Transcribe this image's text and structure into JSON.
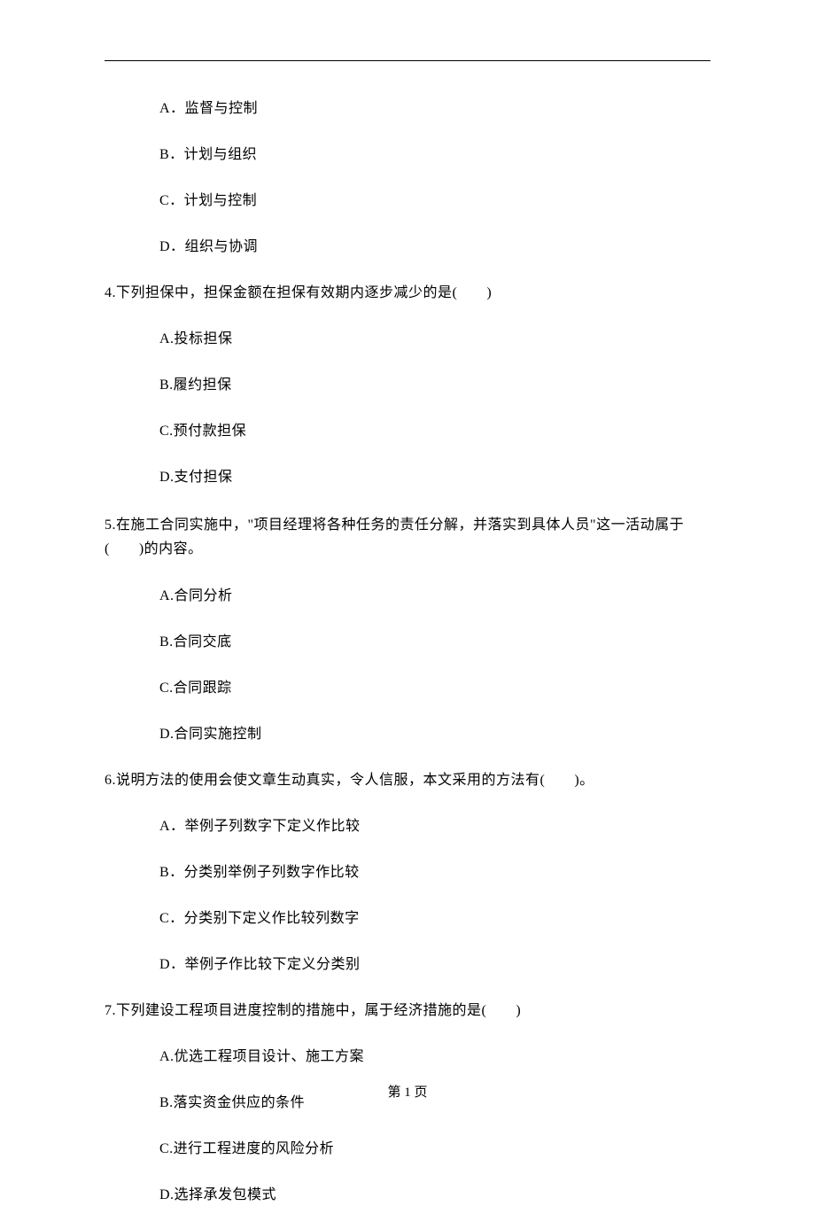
{
  "options_block_1": {
    "a": "A．监督与控制",
    "b": "B．计划与组织",
    "c": "C．计划与控制",
    "d": "D．组织与协调"
  },
  "q4": {
    "stem": "4.下列担保中，担保金额在担保有效期内逐步减少的是(　　)",
    "a": "A.投标担保",
    "b": "B.履约担保",
    "c": "C.预付款担保",
    "d": "D.支付担保"
  },
  "q5": {
    "stem": "5.在施工合同实施中，\"项目经理将各种任务的责任分解，并落实到具体人员\"这一活动属于(　　)的内容。",
    "a": "A.合同分析",
    "b": "B.合同交底",
    "c": "C.合同跟踪",
    "d": "D.合同实施控制"
  },
  "q6": {
    "stem": "6.说明方法的使用会使文章生动真实，令人信服，本文采用的方法有(　　)。",
    "a": "A．举例子列数字下定义作比较",
    "b": "B．分类别举例子列数字作比较",
    "c": "C．分类别下定义作比较列数字",
    "d": "D．举例子作比较下定义分类别"
  },
  "q7": {
    "stem": "7.下列建设工程项目进度控制的措施中，属于经济措施的是(　　)",
    "a": "A.优选工程项目设计、施工方案",
    "b": "B.落实资金供应的条件",
    "c": "C.进行工程进度的风险分析",
    "d": "D.选择承发包模式"
  },
  "footer": {
    "page_label": "第 1 页"
  }
}
